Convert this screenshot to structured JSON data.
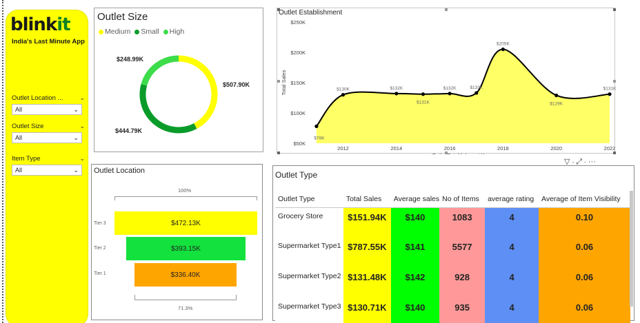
{
  "sidebar": {
    "logo_main": "blink",
    "logo_accent": "it",
    "tagline": "India's Last Minute App",
    "slicers": [
      {
        "label": "Outlet Location ...",
        "value": "All"
      },
      {
        "label": "Outlet Size",
        "value": "All"
      },
      {
        "label": "Item Type",
        "value": "All"
      }
    ]
  },
  "outlet_size": {
    "title": "Outlet Size",
    "legend": [
      "Medium",
      "Small",
      "High"
    ],
    "colors": [
      "#ffff00",
      "#0a9c2a",
      "#3ddc4a"
    ],
    "values_label": [
      "$507.90K",
      "$444.79K",
      "$248.99K"
    ],
    "values": [
      507.9,
      444.79,
      248.99
    ]
  },
  "outlet_establishment": {
    "title": "Outlet Establishment",
    "chart_data": {
      "type": "area",
      "title": "Outlet Establishment",
      "xlabel": "Outlet Establishment Year",
      "ylabel": "Total Sales",
      "x": [
        2011,
        2012,
        2014,
        2015,
        2016,
        2017,
        2018,
        2020,
        2022
      ],
      "values": [
        78,
        130,
        132,
        131,
        132,
        133,
        205,
        129,
        131
      ],
      "point_labels": [
        "$78K",
        "$130K",
        "$132K",
        "$131K",
        "$132K",
        "$133K",
        "$205K",
        "$129K",
        "$131K"
      ],
      "x_ticks": [
        "2012",
        "2014",
        "2016",
        "2018",
        "2020",
        "2022"
      ],
      "y_ticks": [
        "$50K",
        "$100K",
        "$150K",
        "$200K",
        "$250K"
      ],
      "ylim": [
        50,
        250
      ],
      "xlim": [
        2010.9,
        2022
      ],
      "fill_color": "#ffff66",
      "line_color": "#000000"
    }
  },
  "outlet_location": {
    "title": "Outlet Location",
    "top_pct": "100%",
    "bottom_pct": "71.3%",
    "tiers": [
      {
        "label": "Tier 3",
        "value": "$472.13K",
        "color": "#ffff00"
      },
      {
        "label": "Tier 2",
        "value": "$393.15K",
        "color": "#13e13d"
      },
      {
        "label": "Tier 1",
        "value": "$336.40K",
        "color": "#ffa500"
      }
    ]
  },
  "outlet_type": {
    "title": "Outlet Type",
    "columns": [
      "Outlet Type",
      "Total Sales",
      "Average sales",
      "No of Items",
      "average rating",
      "Average of Item Visibility"
    ],
    "rows": [
      {
        "name": "Grocery Store",
        "sales": "$151.94K",
        "avg": "$140",
        "items": "1083",
        "rating": "4",
        "vis": "0.10"
      },
      {
        "name": "Supermarket Type1",
        "sales": "$787.55K",
        "avg": "$141",
        "items": "5577",
        "rating": "4",
        "vis": "0.06"
      },
      {
        "name": "Supermarket Type2",
        "sales": "$131.48K",
        "avg": "$142",
        "items": "928",
        "rating": "4",
        "vis": "0.06"
      },
      {
        "name": "Supermarket Type3",
        "sales": "$130.71K",
        "avg": "$140",
        "items": "935",
        "rating": "4",
        "vis": "0.06"
      }
    ]
  }
}
